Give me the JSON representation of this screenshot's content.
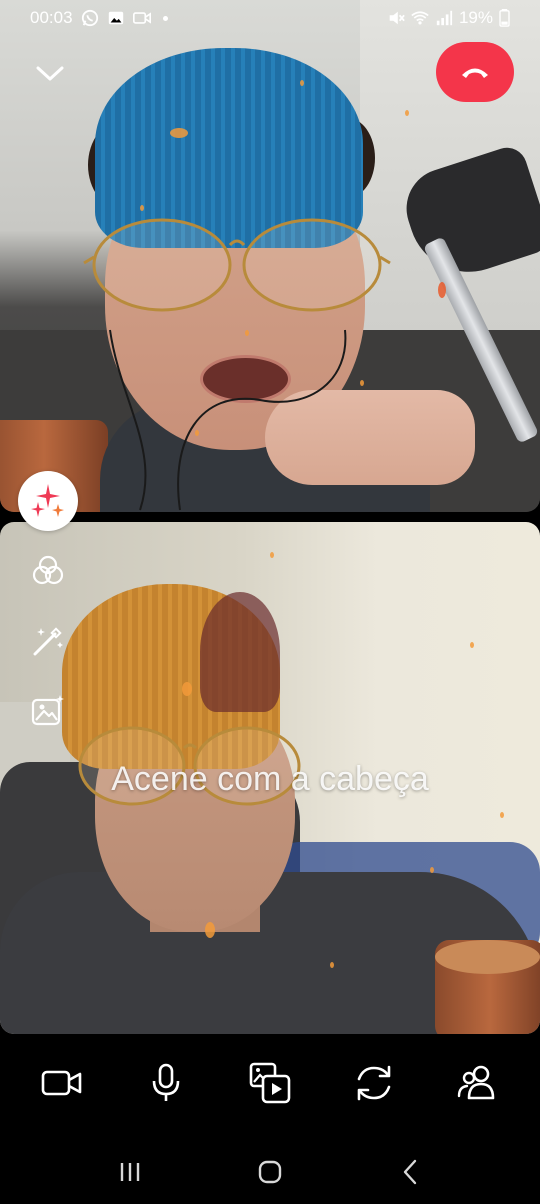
{
  "status_bar": {
    "time": "00:03",
    "battery": "19%",
    "icons": [
      "whatsapp-icon",
      "gallery-icon",
      "video-icon",
      "mute-icon",
      "wifi-icon",
      "signal-icon",
      "battery-icon"
    ]
  },
  "call": {
    "ar_prompt": "Acene com a cabeça",
    "colors": {
      "end_call": "#f4354a",
      "background": "#000000",
      "effects_accent": "#ef3a55"
    }
  },
  "side_tools": [
    "effects-sparkle-icon",
    "filters-icon",
    "magic-wand-icon",
    "background-image-icon"
  ],
  "bottom_controls": [
    "camera-icon",
    "microphone-icon",
    "media-share-icon",
    "switch-camera-icon",
    "participants-icon"
  ],
  "nav": [
    "recents-icon",
    "home-icon",
    "back-icon"
  ]
}
